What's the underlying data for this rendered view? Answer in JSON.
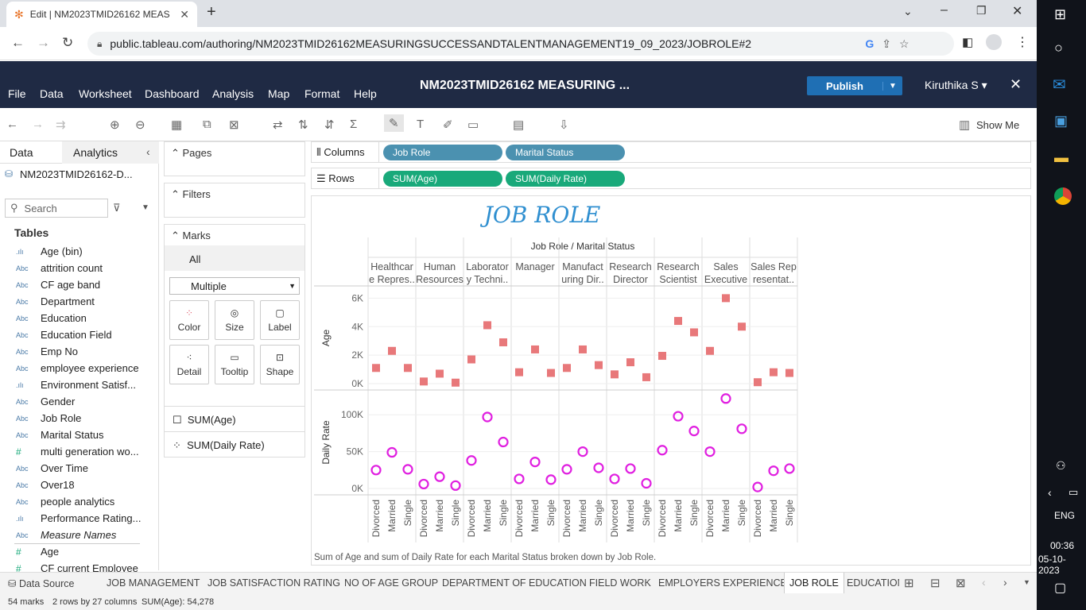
{
  "browser": {
    "tab_title": "Edit | NM2023TMID26162 MEAS",
    "url": "public.tableau.com/authoring/NM2023TMID26162MEASURINGSUCCESSANDTALENTMANAGEMENT19_09_2023/JOBROLE#2"
  },
  "menu": {
    "items": [
      "File",
      "Data",
      "Worksheet",
      "Dashboard",
      "Analysis",
      "Map",
      "Format",
      "Help"
    ],
    "workbook_title": "NM2023TMID26162 MEASURING ...",
    "publish_label": "Publish",
    "user": "Kiruthika S",
    "show_me": "Show Me"
  },
  "data_pane": {
    "tab_data": "Data",
    "tab_analytics": "Analytics",
    "datasource": "NM2023TMID26162-D...",
    "search_placeholder": "Search",
    "tables_label": "Tables",
    "fields": [
      {
        "icon": ".ılı",
        "name": "Age (bin)"
      },
      {
        "icon": "Abc",
        "name": "attrition count"
      },
      {
        "icon": "Abc",
        "name": "CF age band"
      },
      {
        "icon": "Abc",
        "name": "Department"
      },
      {
        "icon": "Abc",
        "name": "Education"
      },
      {
        "icon": "Abc",
        "name": "Education Field"
      },
      {
        "icon": "Abc",
        "name": "Emp No"
      },
      {
        "icon": "Abc",
        "name": "employee experience"
      },
      {
        "icon": ".ılı",
        "name": "Environment Satisf..."
      },
      {
        "icon": "Abc",
        "name": "Gender"
      },
      {
        "icon": "Abc",
        "name": "Job Role"
      },
      {
        "icon": "Abc",
        "name": "Marital Status"
      },
      {
        "icon": "#",
        "name": "multi generation wo..."
      },
      {
        "icon": "Abc",
        "name": "Over Time"
      },
      {
        "icon": "Abc",
        "name": "Over18"
      },
      {
        "icon": "Abc",
        "name": "people analytics"
      },
      {
        "icon": ".ılı",
        "name": "Performance Rating..."
      },
      {
        "icon": "Abc",
        "name": "Measure Names"
      },
      {
        "icon": "#",
        "name": "Age"
      },
      {
        "icon": "#",
        "name": "CF current Employee"
      }
    ]
  },
  "cards": {
    "pages": "Pages",
    "filters": "Filters",
    "marks": "Marks",
    "all": "All",
    "mark_type": "Multiple",
    "buttons": [
      "Color",
      "Size",
      "Label",
      "Detail",
      "Tooltip",
      "Shape"
    ],
    "measure1": "SUM(Age)",
    "measure2": "SUM(Daily Rate)"
  },
  "shelves": {
    "columns_label": "Columns",
    "rows_label": "Rows",
    "columns": [
      "Job Role",
      "Marital Status"
    ],
    "rows": [
      "SUM(Age)",
      "SUM(Daily Rate)"
    ]
  },
  "viz": {
    "title": "JOB ROLE",
    "header": "Job Role / Marital Status",
    "caption": "Sum of Age and sum of Daily Rate for each Marital Status broken down by Job Role."
  },
  "chart_data": {
    "type": "scatter",
    "categories": [
      [
        "Healthcar",
        "e Repres.."
      ],
      [
        "Human",
        "Resources"
      ],
      [
        "Laborator",
        "y Techni.."
      ],
      [
        "Manager",
        ""
      ],
      [
        "Manufact",
        "uring Dir.."
      ],
      [
        "Research",
        "Director"
      ],
      [
        "Research",
        "Scientist"
      ],
      [
        "Sales",
        "Executive"
      ],
      [
        "Sales Rep",
        "resentat.."
      ]
    ],
    "sub_categories": [
      "Divorced",
      "Married",
      "Single"
    ],
    "series": [
      {
        "name": "Age",
        "ylabel": "Age",
        "ticks": [
          "6K",
          "4K",
          "2K",
          "0K"
        ],
        "ylim": [
          0,
          6300
        ],
        "tick_values": [
          6000,
          4000,
          2000,
          0
        ],
        "color": "#e8787a",
        "shape": "square",
        "values": [
          1100,
          2300,
          1100,
          150,
          700,
          70,
          1700,
          4100,
          2900,
          800,
          2400,
          750,
          1100,
          2400,
          1300,
          650,
          1500,
          450,
          1950,
          4400,
          3600,
          2300,
          6000,
          4000,
          100,
          800,
          750
        ]
      },
      {
        "name": "Daily Rate",
        "ylabel": "Daily Rate",
        "ticks": [
          "100K",
          "50K",
          "0K"
        ],
        "ylim": [
          0,
          125000
        ],
        "tick_values": [
          100000,
          50000,
          0
        ],
        "color": "#e01fe0",
        "shape": "circle",
        "values": [
          25000,
          49000,
          26000,
          6000,
          16000,
          4000,
          38000,
          97000,
          63000,
          13000,
          36000,
          12000,
          26000,
          50000,
          28000,
          13000,
          27000,
          7000,
          52000,
          98000,
          78000,
          50000,
          122000,
          81000,
          2000,
          24000,
          27000
        ]
      }
    ]
  },
  "sheets": {
    "datasource_tab": "Data Source",
    "tabs": [
      "JOB MANAGEMENT",
      "JOB SATISFACTION RATING",
      "NO OF AGE GROUP",
      "DEPARTMENT OF EDUCATION",
      "FIELD WORK",
      "EMPLOYERS EXPERIENCE",
      "JOB ROLE",
      "EDUCATION"
    ],
    "active": "JOB ROLE"
  },
  "status": {
    "marks": "54 marks",
    "dims": "2 rows by 27 columns",
    "sum": "SUM(Age): 54,278"
  },
  "taskbar": {
    "lang": "ENG",
    "time": "00:36",
    "date": "05-10-2023"
  }
}
